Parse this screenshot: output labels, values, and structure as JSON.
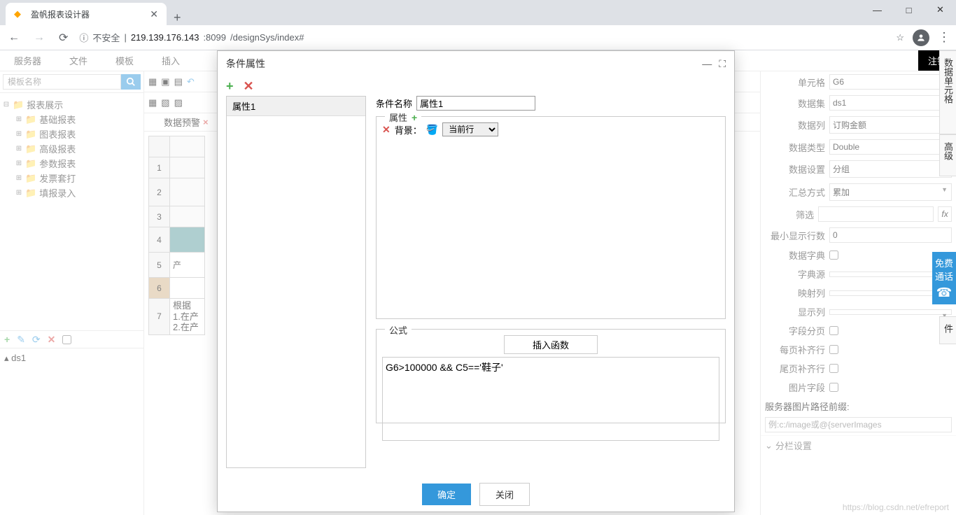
{
  "browser": {
    "tab_title": "盈帆报表设计器",
    "url_warning": "不安全",
    "url_host": "219.139.176.143",
    "url_port": ":8099",
    "url_path": "/designSys/index#"
  },
  "menubar": [
    "服务器",
    "文件",
    "模板",
    "插入"
  ],
  "logout": "注销",
  "left": {
    "search_placeholder": "模板名称",
    "tree_root": "报表展示",
    "tree_items": [
      "基础报表",
      "图表报表",
      "高级报表",
      "参数报表",
      "发票套打",
      "填报录入"
    ],
    "ds_item": "ds1"
  },
  "mid": {
    "tab_label": "数据预警",
    "row_labels": [
      "1",
      "2",
      "3",
      "4",
      "5",
      "6",
      "7"
    ],
    "cell_5b": "产",
    "note_line1": "根据",
    "note_line2": "1.在产",
    "note_line3": "2.在产"
  },
  "right": {
    "cell_label": "单元格",
    "cell_value": "G6",
    "dataset_label": "数据集",
    "dataset_value": "ds1",
    "datacol_label": "数据列",
    "datacol_value": "订购金额",
    "datatype_label": "数据类型",
    "datatype_value": "Double",
    "datasetting_label": "数据设置",
    "datasetting_value": "分组",
    "summary_label": "汇总方式",
    "summary_value": "累加",
    "filter_label": "筛选",
    "minrows_label": "最小显示行数",
    "minrows_value": "0",
    "dict_label": "数据字典",
    "dictsrc_label": "字典源",
    "mapcol_label": "映射列",
    "dispcol_label": "显示列",
    "fieldpage_label": "字段分页",
    "pagefill_label": "每页补齐行",
    "tailfill_label": "尾页补齐行",
    "imgfield_label": "图片字段",
    "imgprefix_label": "服务器图片路径前缀:",
    "imgprefix_placeholder": "例:c:/image或@{serverImages",
    "section_label": "分栏设置",
    "sidetab1": "数据单元格",
    "sidetab2": "高级",
    "sidetab3": "件"
  },
  "float_call": {
    "line1": "免费",
    "line2": "通话"
  },
  "modal": {
    "title": "条件属性",
    "name_label": "条件名称",
    "name_value": "属性1",
    "list_item": "属性1",
    "attrs_legend": "属性",
    "bg_label": "背景：",
    "bg_value": "当前行",
    "formula_legend": "公式",
    "insert_fn": "插入函数",
    "formula_text": "G6>100000 && C5=='鞋子'",
    "ok": "确定",
    "close": "关闭"
  },
  "watermark": "https://blog.csdn.net/efreport"
}
